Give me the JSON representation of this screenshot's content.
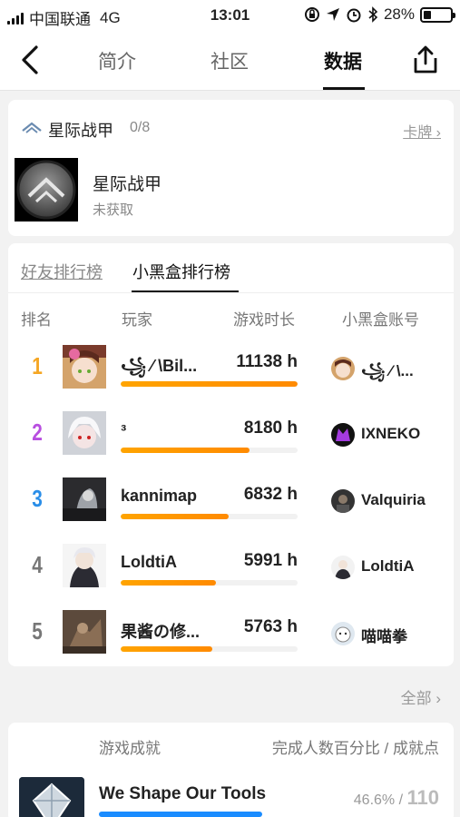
{
  "status_bar": {
    "carrier": "中国联通",
    "network": "4G",
    "time": "13:01",
    "battery": "28%",
    "battery_level": 0.28
  },
  "nav": {
    "tabs": [
      {
        "label": "简介",
        "active": false
      },
      {
        "label": "社区",
        "active": false
      },
      {
        "label": "数据",
        "active": true
      }
    ],
    "back_icon": "chevron-left-icon",
    "share_icon": "share-icon"
  },
  "game": {
    "name": "星际战甲",
    "count": "0/8",
    "link": "卡牌",
    "card_title": "星际战甲",
    "card_subtitle": "未获取"
  },
  "ranking": {
    "tabs": [
      {
        "label": "好友排行榜",
        "active": false
      },
      {
        "label": "小黑盒排行榜",
        "active": true
      }
    ],
    "columns": {
      "rank": "排名",
      "player": "玩家",
      "playtime": "游戏时长",
      "account": "小黑盒账号"
    },
    "rows": [
      {
        "rank": "1",
        "player": "꧁ ⁄ \\Bil...",
        "hours": "11138 h",
        "fraction": 1.0,
        "account": "꧁ ⁄ \\...",
        "rank_color": "#f5a623"
      },
      {
        "rank": "2",
        "player": "ᵌ",
        "hours": "8180 h",
        "fraction": 0.73,
        "account": "IXNEKO",
        "rank_color": "#b84fe0"
      },
      {
        "rank": "3",
        "player": "kannimap",
        "hours": "6832 h",
        "fraction": 0.61,
        "account": "Valquiria",
        "rank_color": "#2a8ee8"
      },
      {
        "rank": "4",
        "player": "LoldtiA",
        "hours": "5991 h",
        "fraction": 0.54,
        "account": "LoldtiA",
        "rank_color": "#777777"
      },
      {
        "rank": "5",
        "player": "果酱の修...",
        "hours": "5763 h",
        "fraction": 0.52,
        "account": "喵喵拳",
        "rank_color": "#777777"
      }
    ],
    "all_link": "全部"
  },
  "achievements": {
    "header_left": "游戏成就",
    "header_right": "完成人数百分比 / 成就点",
    "items": [
      {
        "name": "We Shape Our Tools",
        "percent": "46.6% /",
        "points": "110"
      }
    ]
  },
  "colors": {
    "accent_orange": "#ff9500",
    "accent_blue": "#1a8cff"
  }
}
